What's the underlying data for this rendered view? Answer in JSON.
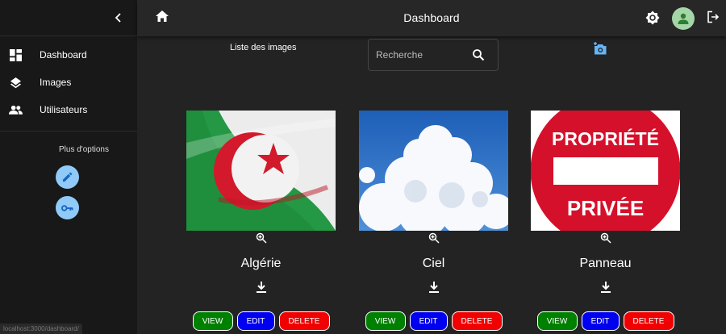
{
  "sidebar": {
    "items": [
      {
        "label": "Dashboard",
        "icon": "dashboard-icon"
      },
      {
        "label": "Images",
        "icon": "layers-icon"
      },
      {
        "label": "Utilisateurs",
        "icon": "people-icon"
      }
    ],
    "more_label": "Plus d'options",
    "status_url": "localhost:3000/dashboard/"
  },
  "header": {
    "title": "Dashboard"
  },
  "main": {
    "list_title": "Liste des images",
    "search_placeholder": "Recherche",
    "cards": [
      {
        "name": "Algérie",
        "view": "VIEW",
        "edit": "EDIT",
        "delete": "DELETE"
      },
      {
        "name": "Ciel",
        "view": "VIEW",
        "edit": "EDIT",
        "delete": "DELETE"
      },
      {
        "name": "Panneau",
        "view": "VIEW",
        "edit": "EDIT",
        "delete": "DELETE",
        "sign_top": "PROPRIÉTÉ",
        "sign_bottom": "PRIVÉE"
      }
    ]
  },
  "colors": {
    "view": "#008000",
    "edit": "#0000f0",
    "delete": "#f00000",
    "accent": "#90caf9",
    "avatar": "#a5d6a7"
  }
}
